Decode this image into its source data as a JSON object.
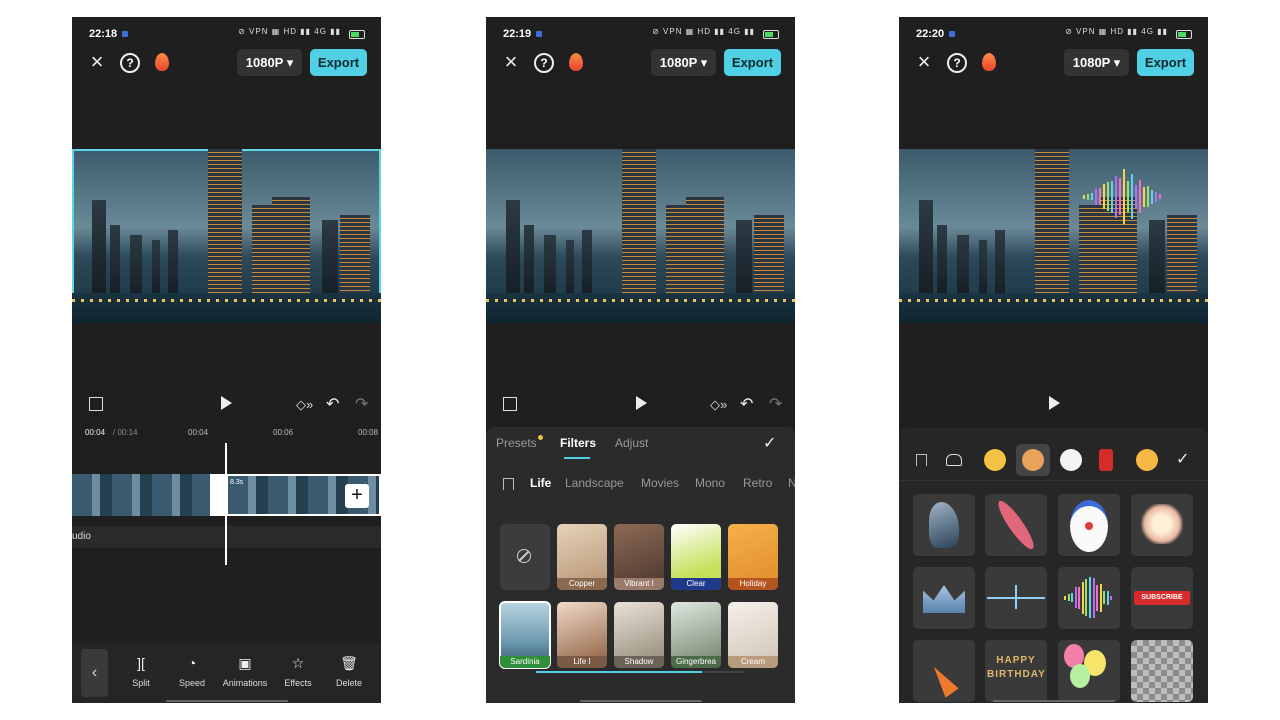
{
  "screens": [
    {
      "time": "22:18",
      "resolution": "1080P ▾",
      "export_label": "Export",
      "timeline": {
        "current": "00:04",
        "total": "/ 00:14",
        "ticks": [
          "00:04",
          "00:06",
          "00:08"
        ],
        "clip_duration": "8.3s",
        "audio_label": "udio"
      },
      "tools": [
        {
          "label": "Split",
          "icon": "split-icon"
        },
        {
          "label": "Speed",
          "icon": "speed-icon"
        },
        {
          "label": "Animations",
          "icon": "animations-icon"
        },
        {
          "label": "Effects",
          "icon": "effects-icon"
        },
        {
          "label": "Delete",
          "icon": "delete-icon"
        }
      ]
    },
    {
      "time": "22:19",
      "resolution": "1080P ▾",
      "export_label": "Export",
      "tabs": [
        "Presets",
        "Filters",
        "Adjust"
      ],
      "active_tab": "Filters",
      "categories": [
        "Life",
        "Landscape",
        "Movies",
        "Mono",
        "Retro",
        "N"
      ],
      "active_category": "Life",
      "filters_row1": [
        "Copper",
        "Vibrant I",
        "Clear",
        "Holiday"
      ],
      "filters_row2": [
        "Sardinia",
        "Life I",
        "Shadow",
        "Gingerbrea",
        "Cream"
      ],
      "selected_filter": "Sardinia",
      "filter_accent": "#2f8f3a"
    },
    {
      "time": "22:20",
      "resolution": "1080P ▾",
      "export_label": "Export",
      "sticker_categories": [
        "bookmark-icon",
        "sticker-cat-icon",
        "emoji-icon",
        "hot-icon",
        "sticker-ball-icon",
        "sticker-bolt-icon",
        "sticker-wink-icon"
      ],
      "stickers": [
        {
          "name": "horse-sticker"
        },
        {
          "name": "surfboard-sticker"
        },
        {
          "name": "clown-sticker"
        },
        {
          "name": "heart-sticker"
        },
        {
          "name": "crown-sticker"
        },
        {
          "name": "line-wave-sticker"
        },
        {
          "name": "color-wave-sticker"
        },
        {
          "name": "subscribe-sticker",
          "text": "SUBSCRIBE"
        },
        {
          "name": "party-horn-sticker"
        },
        {
          "name": "happy-birthday-sticker",
          "text": "HAPPY BIRTHDAY"
        },
        {
          "name": "balloons-sticker"
        },
        {
          "name": "pixel-sticker"
        }
      ]
    }
  ]
}
